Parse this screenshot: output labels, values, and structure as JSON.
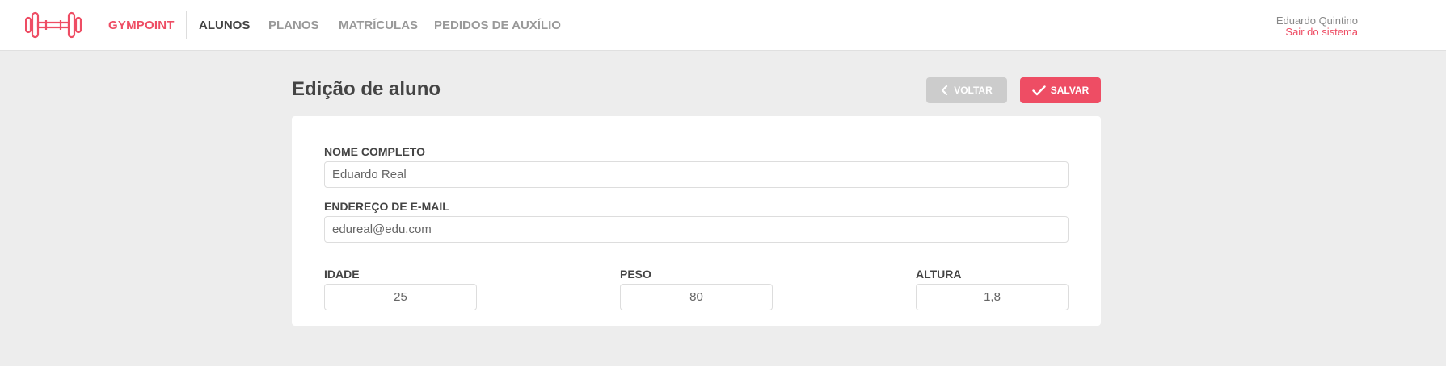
{
  "header": {
    "brand": "GYMPOINT",
    "nav": [
      {
        "label": "ALUNOS",
        "active": true
      },
      {
        "label": "PLANOS",
        "active": false
      },
      {
        "label": "MATRÍCULAS",
        "active": false
      },
      {
        "label": "PEDIDOS DE AUXÍLIO",
        "active": false
      }
    ],
    "user_name": "Eduardo Quintino",
    "logout_label": "Sair do sistema"
  },
  "page": {
    "title": "Edição de aluno",
    "back_label": "VOLTAR",
    "save_label": "SALVAR"
  },
  "form": {
    "name": {
      "label": "NOME COMPLETO",
      "value": "Eduardo Real"
    },
    "email": {
      "label": "ENDEREÇO DE E-MAIL",
      "value": "edureal@edu.com"
    },
    "age": {
      "label": "IDADE",
      "value": "25"
    },
    "weight": {
      "label": "PESO",
      "value": "80"
    },
    "height": {
      "label": "ALTURA",
      "value": "1,8"
    }
  },
  "icons": {
    "logo": "dumbbell-icon",
    "back": "chevron-left-icon",
    "save": "check-icon"
  },
  "colors": {
    "accent": "#ee4d64",
    "background": "#ededed",
    "disabled_button": "#cccccc"
  }
}
